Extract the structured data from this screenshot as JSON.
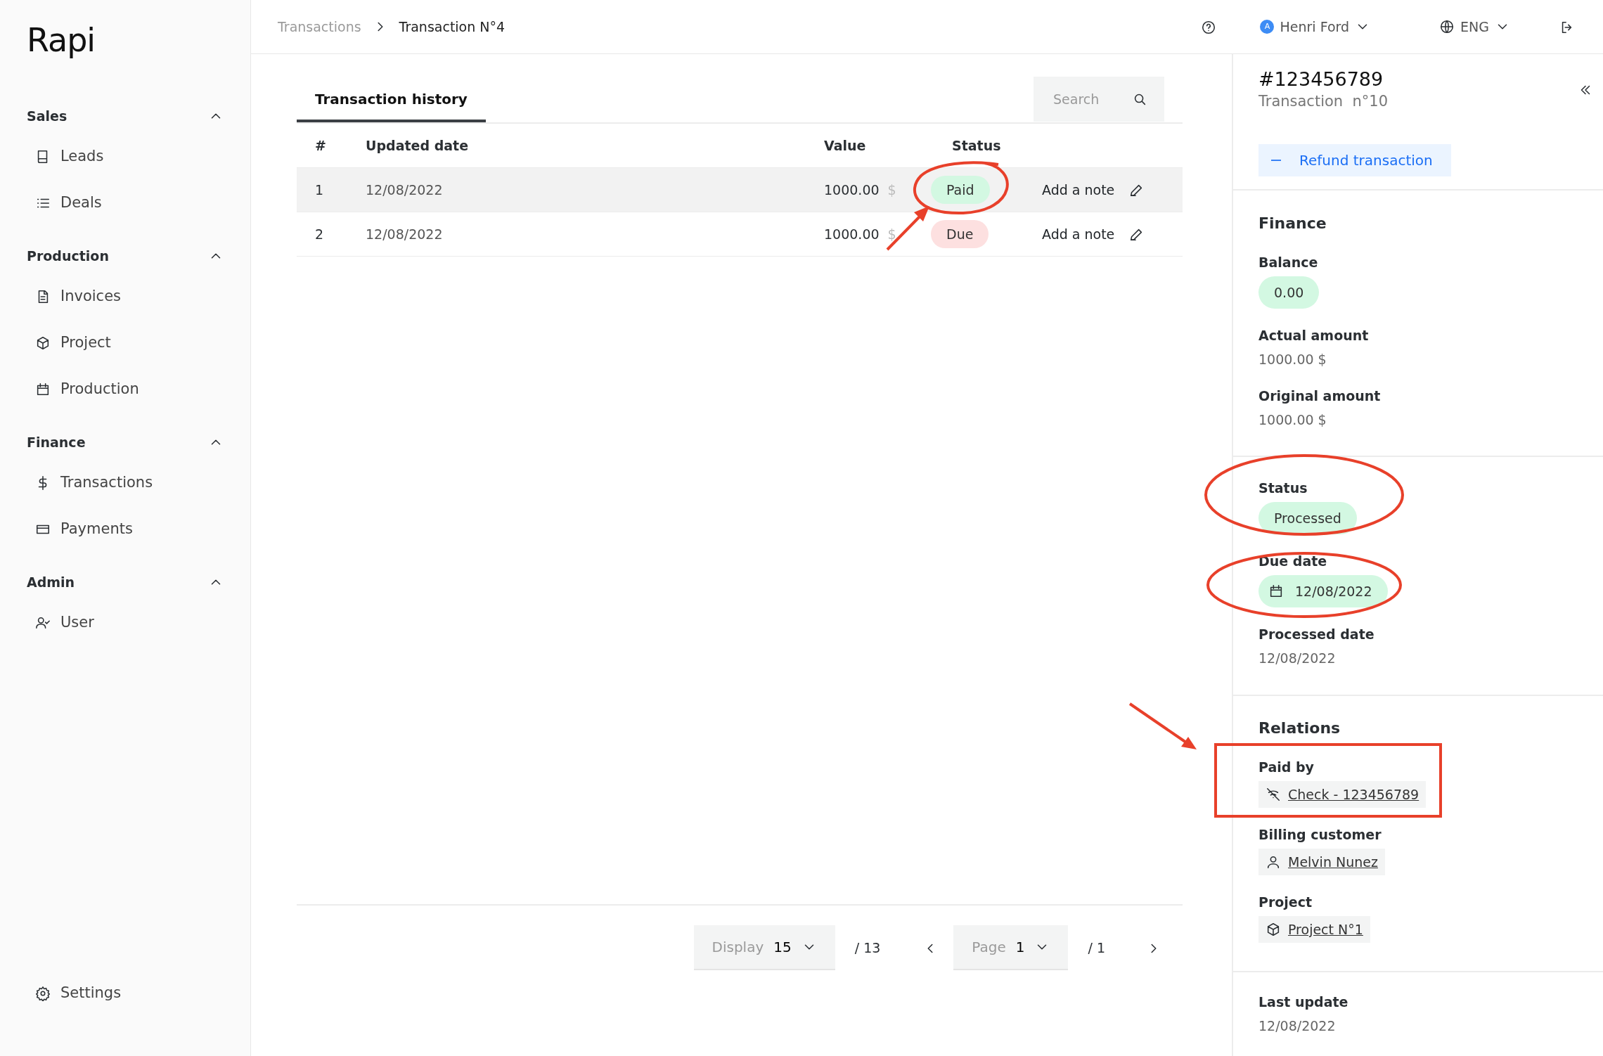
{
  "sidebar": {
    "logo": "Rapi",
    "sections": [
      {
        "title": "Sales",
        "expanded": true,
        "items": [
          {
            "label": "Leads"
          },
          {
            "label": "Deals"
          }
        ]
      },
      {
        "title": "Production",
        "expanded": true,
        "items": [
          {
            "label": "Invoices"
          },
          {
            "label": "Project"
          },
          {
            "label": "Production"
          }
        ]
      },
      {
        "title": "Finance",
        "expanded": true,
        "items": [
          {
            "label": "Transactions"
          },
          {
            "label": "Payments"
          }
        ]
      },
      {
        "title": "Admin",
        "expanded": true,
        "items": [
          {
            "label": "User"
          }
        ]
      }
    ],
    "settings": "Settings"
  },
  "header": {
    "breadcrumb": [
      "Transactions",
      "Transaction N°4"
    ],
    "user": {
      "initial": "A",
      "name": "Henri Ford"
    },
    "language": "ENG"
  },
  "main": {
    "tabs": [
      {
        "label": "Transaction history",
        "selected": true
      }
    ],
    "search": {
      "placeholder": "Search"
    },
    "table": {
      "columns": [
        "#",
        "Updated date",
        "Value",
        "Status"
      ],
      "rows": [
        {
          "number": "1",
          "date": "12/08/2022",
          "value": "1000.00",
          "currency": "$",
          "status": "Paid",
          "color": "#d3f8e2",
          "note": "Add a note",
          "selected": true
        },
        {
          "number": "2",
          "date": "12/08/2022",
          "value": "1000.00",
          "currency": "$",
          "status": "Due",
          "color": "#fde0e0",
          "note": "Add a note",
          "selected": false
        }
      ]
    },
    "pagination": {
      "display_label": "Display",
      "display_value": "15",
      "display_total": "/ 13",
      "page_label": "Page",
      "page_value": "1",
      "page_total": "/ 1"
    }
  },
  "panel": {
    "id": "#123456789",
    "subtitle": "Transaction  n°10",
    "refund": "Refund transaction",
    "sections": [
      {
        "title": "Finance",
        "fields": [
          {
            "label": "Balance",
            "value": "0.00",
            "kind": "pill"
          },
          {
            "label": "Actual amount",
            "value": "1000.00 $",
            "kind": "text"
          },
          {
            "label": "Original amount",
            "value": "1000.00 $",
            "kind": "text"
          }
        ]
      },
      {
        "fields": [
          {
            "label": "Status",
            "value": "Processed",
            "kind": "pill"
          },
          {
            "label": "Due date",
            "value": "12/08/2022",
            "kind": "date"
          },
          {
            "label": "Processed date",
            "value": "12/08/2022",
            "kind": "text"
          }
        ]
      },
      {
        "title": "Relations",
        "fields": [
          {
            "label": "Paid by",
            "value": "Check - 123456789",
            "kind": "payment-link"
          },
          {
            "label": "Billing customer",
            "value": "Melvin Nunez",
            "kind": "person-link"
          },
          {
            "label": "Project",
            "value": "Project N°1",
            "kind": "project-link"
          }
        ]
      },
      {
        "fields": [
          {
            "label": "Last update",
            "value": "12/08/2022",
            "kind": "text"
          }
        ]
      }
    ]
  }
}
